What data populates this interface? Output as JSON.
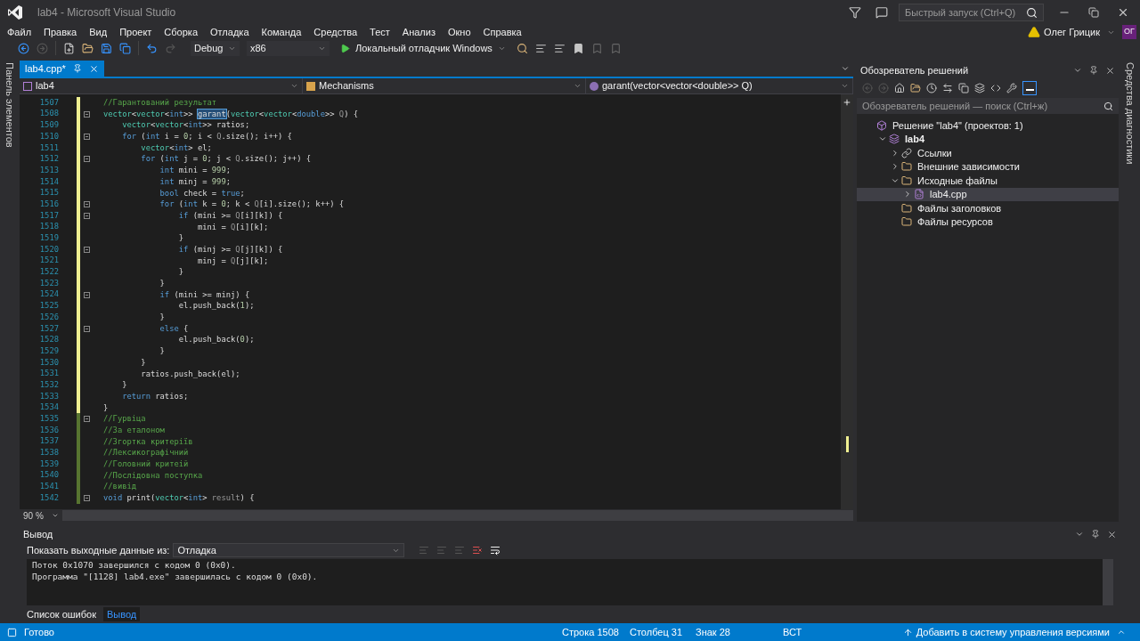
{
  "window": {
    "title": "lab4 - Microsoft Visual Studio"
  },
  "quick_launch": {
    "placeholder": "Быстрый запуск (Ctrl+Q)"
  },
  "user": {
    "name": "Олег Грицик",
    "initials": "ОГ"
  },
  "menu": [
    "Файл",
    "Правка",
    "Вид",
    "Проект",
    "Сборка",
    "Отладка",
    "Команда",
    "Средства",
    "Тест",
    "Анализ",
    "Окно",
    "Справка"
  ],
  "toolbar": {
    "configuration": "Debug",
    "platform": "x86",
    "run": "Локальный отладчик Windows"
  },
  "left_strip": "Панель элементов",
  "right_strip": "Средства диагностики",
  "editor": {
    "tabs": [
      {
        "label": "lab4.cpp*",
        "selected": true
      }
    ],
    "nav": [
      "lab4",
      "Mechanisms",
      "garant(vector<vector<double>> Q)"
    ],
    "zoom": "90 %",
    "lines": [
      {
        "number": "1507",
        "saved": false,
        "foldable": false,
        "tokens": [
          {
            "kind": "comment",
            "text": "//Гарантований результат"
          }
        ]
      },
      {
        "number": "1508",
        "saved": false,
        "foldable": true,
        "tokens": [
          {
            "kind": "type",
            "text": "vector"
          },
          {
            "kind": "plain",
            "text": "<"
          },
          {
            "kind": "type",
            "text": "vector"
          },
          {
            "kind": "plain",
            "text": "<"
          },
          {
            "kind": "kw",
            "text": "int"
          },
          {
            "kind": "plain",
            "text": ">> "
          },
          {
            "kind": "selection",
            "text": "garant"
          },
          {
            "kind": "plain",
            "text": "("
          },
          {
            "kind": "type",
            "text": "vector"
          },
          {
            "kind": "plain",
            "text": "<"
          },
          {
            "kind": "type",
            "text": "vector"
          },
          {
            "kind": "plain",
            "text": "<"
          },
          {
            "kind": "kw",
            "text": "double"
          },
          {
            "kind": "plain",
            "text": ">> "
          },
          {
            "kind": "param",
            "text": "Q"
          },
          {
            "kind": "plain",
            "text": ") {"
          }
        ]
      },
      {
        "number": "1509",
        "saved": false,
        "foldable": false,
        "tokens": [
          {
            "kind": "type",
            "text": "    vector"
          },
          {
            "kind": "plain",
            "text": "<"
          },
          {
            "kind": "type",
            "text": "vector"
          },
          {
            "kind": "plain",
            "text": "<"
          },
          {
            "kind": "kw",
            "text": "int"
          },
          {
            "kind": "plain",
            "text": ">> ratios;"
          }
        ]
      },
      {
        "number": "1510",
        "saved": false,
        "foldable": true,
        "tokens": [
          {
            "kind": "kw",
            "text": "    for"
          },
          {
            "kind": "plain",
            "text": " ("
          },
          {
            "kind": "kw",
            "text": "int"
          },
          {
            "kind": "plain",
            "text": " i = "
          },
          {
            "kind": "num",
            "text": "0"
          },
          {
            "kind": "plain",
            "text": "; i < "
          },
          {
            "kind": "param",
            "text": "Q"
          },
          {
            "kind": "plain",
            "text": ".size(); i++) {"
          }
        ]
      },
      {
        "number": "1511",
        "saved": false,
        "foldable": false,
        "tokens": [
          {
            "kind": "type",
            "text": "        vector"
          },
          {
            "kind": "plain",
            "text": "<"
          },
          {
            "kind": "kw",
            "text": "int"
          },
          {
            "kind": "plain",
            "text": "> el;"
          }
        ]
      },
      {
        "number": "1512",
        "saved": false,
        "foldable": true,
        "tokens": [
          {
            "kind": "kw",
            "text": "        for"
          },
          {
            "kind": "plain",
            "text": " ("
          },
          {
            "kind": "kw",
            "text": "int"
          },
          {
            "kind": "plain",
            "text": " j = "
          },
          {
            "kind": "num",
            "text": "0"
          },
          {
            "kind": "plain",
            "text": "; j < "
          },
          {
            "kind": "param",
            "text": "Q"
          },
          {
            "kind": "plain",
            "text": ".size(); j++) {"
          }
        ]
      },
      {
        "number": "1513",
        "saved": false,
        "foldable": false,
        "tokens": [
          {
            "kind": "kw",
            "text": "            int"
          },
          {
            "kind": "plain",
            "text": " mini = "
          },
          {
            "kind": "num",
            "text": "999"
          },
          {
            "kind": "plain",
            "text": ";"
          }
        ]
      },
      {
        "number": "1514",
        "saved": false,
        "foldable": false,
        "tokens": [
          {
            "kind": "kw",
            "text": "            int"
          },
          {
            "kind": "plain",
            "text": " minj = "
          },
          {
            "kind": "num",
            "text": "999"
          },
          {
            "kind": "plain",
            "text": ";"
          }
        ]
      },
      {
        "number": "1515",
        "saved": false,
        "foldable": false,
        "tokens": [
          {
            "kind": "kw",
            "text": "            bool"
          },
          {
            "kind": "plain",
            "text": " check = "
          },
          {
            "kind": "kw",
            "text": "true"
          },
          {
            "kind": "plain",
            "text": ";"
          }
        ]
      },
      {
        "number": "1516",
        "saved": false,
        "foldable": true,
        "tokens": [
          {
            "kind": "kw",
            "text": "            for"
          },
          {
            "kind": "plain",
            "text": " ("
          },
          {
            "kind": "kw",
            "text": "int"
          },
          {
            "kind": "plain",
            "text": " k = "
          },
          {
            "kind": "num",
            "text": "0"
          },
          {
            "kind": "plain",
            "text": "; k < "
          },
          {
            "kind": "param",
            "text": "Q"
          },
          {
            "kind": "plain",
            "text": "[i].size(); k++) {"
          }
        ]
      },
      {
        "number": "1517",
        "saved": false,
        "foldable": true,
        "tokens": [
          {
            "kind": "kw",
            "text": "                if"
          },
          {
            "kind": "plain",
            "text": " (mini >= "
          },
          {
            "kind": "param",
            "text": "Q"
          },
          {
            "kind": "plain",
            "text": "[i][k]) {"
          }
        ]
      },
      {
        "number": "1518",
        "saved": false,
        "foldable": false,
        "tokens": [
          {
            "kind": "plain",
            "text": "                    mini = "
          },
          {
            "kind": "param",
            "text": "Q"
          },
          {
            "kind": "plain",
            "text": "[i][k];"
          }
        ]
      },
      {
        "number": "1519",
        "saved": false,
        "foldable": false,
        "tokens": [
          {
            "kind": "plain",
            "text": "                }"
          }
        ]
      },
      {
        "number": "1520",
        "saved": false,
        "foldable": true,
        "tokens": [
          {
            "kind": "kw",
            "text": "                if"
          },
          {
            "kind": "plain",
            "text": " (minj >= "
          },
          {
            "kind": "param",
            "text": "Q"
          },
          {
            "kind": "plain",
            "text": "[j][k]) {"
          }
        ]
      },
      {
        "number": "1521",
        "saved": false,
        "foldable": false,
        "tokens": [
          {
            "kind": "plain",
            "text": "                    minj = "
          },
          {
            "kind": "param",
            "text": "Q"
          },
          {
            "kind": "plain",
            "text": "[j][k];"
          }
        ]
      },
      {
        "number": "1522",
        "saved": false,
        "foldable": false,
        "tokens": [
          {
            "kind": "plain",
            "text": "                }"
          }
        ]
      },
      {
        "number": "1523",
        "saved": false,
        "foldable": false,
        "tokens": [
          {
            "kind": "plain",
            "text": "            }"
          }
        ]
      },
      {
        "number": "1524",
        "saved": false,
        "foldable": true,
        "tokens": [
          {
            "kind": "kw",
            "text": "            if"
          },
          {
            "kind": "plain",
            "text": " (mini >= minj) {"
          }
        ]
      },
      {
        "number": "1525",
        "saved": false,
        "foldable": false,
        "tokens": [
          {
            "kind": "plain",
            "text": "                el.push_back("
          },
          {
            "kind": "num",
            "text": "1"
          },
          {
            "kind": "plain",
            "text": ");"
          }
        ]
      },
      {
        "number": "1526",
        "saved": false,
        "foldable": false,
        "tokens": [
          {
            "kind": "plain",
            "text": "            }"
          }
        ]
      },
      {
        "number": "1527",
        "saved": false,
        "foldable": true,
        "tokens": [
          {
            "kind": "kw",
            "text": "            else"
          },
          {
            "kind": "plain",
            "text": " {"
          }
        ]
      },
      {
        "number": "1528",
        "saved": false,
        "foldable": false,
        "tokens": [
          {
            "kind": "plain",
            "text": "                el.push_back("
          },
          {
            "kind": "num",
            "text": "0"
          },
          {
            "kind": "plain",
            "text": ");"
          }
        ]
      },
      {
        "number": "1529",
        "saved": false,
        "foldable": false,
        "tokens": [
          {
            "kind": "plain",
            "text": "            }"
          }
        ]
      },
      {
        "number": "1530",
        "saved": false,
        "foldable": false,
        "tokens": [
          {
            "kind": "plain",
            "text": "        }"
          }
        ]
      },
      {
        "number": "1531",
        "saved": false,
        "foldable": false,
        "tokens": [
          {
            "kind": "plain",
            "text": "        ratios.push_back(el);"
          }
        ]
      },
      {
        "number": "1532",
        "saved": false,
        "foldable": false,
        "tokens": [
          {
            "kind": "plain",
            "text": "    }"
          }
        ]
      },
      {
        "number": "1533",
        "saved": false,
        "foldable": false,
        "tokens": [
          {
            "kind": "kw",
            "text": "    return"
          },
          {
            "kind": "plain",
            "text": " ratios;"
          }
        ]
      },
      {
        "number": "1534",
        "saved": false,
        "foldable": false,
        "tokens": [
          {
            "kind": "plain",
            "text": "}"
          }
        ]
      },
      {
        "number": "1535",
        "saved": true,
        "foldable": true,
        "tokens": [
          {
            "kind": "comment",
            "text": "//Гурвіца"
          }
        ]
      },
      {
        "number": "1536",
        "saved": true,
        "foldable": false,
        "tokens": [
          {
            "kind": "comment",
            "text": "//За еталоном"
          }
        ]
      },
      {
        "number": "1537",
        "saved": true,
        "foldable": false,
        "tokens": [
          {
            "kind": "comment",
            "text": "//Згортка критеріїв"
          }
        ]
      },
      {
        "number": "1538",
        "saved": true,
        "foldable": false,
        "tokens": [
          {
            "kind": "comment",
            "text": "//Лексикографічний"
          }
        ]
      },
      {
        "number": "1539",
        "saved": true,
        "foldable": false,
        "tokens": [
          {
            "kind": "comment",
            "text": "//Головний критеій"
          }
        ]
      },
      {
        "number": "1540",
        "saved": true,
        "foldable": false,
        "tokens": [
          {
            "kind": "comment",
            "text": "//Послідовна поступка"
          }
        ]
      },
      {
        "number": "1541",
        "saved": true,
        "foldable": false,
        "tokens": [
          {
            "kind": "comment",
            "text": "//вивід"
          }
        ]
      },
      {
        "number": "1542",
        "saved": true,
        "foldable": true,
        "tokens": [
          {
            "kind": "kw",
            "text": "void"
          },
          {
            "kind": "plain",
            "text": " print("
          },
          {
            "kind": "type",
            "text": "vector"
          },
          {
            "kind": "plain",
            "text": "<"
          },
          {
            "kind": "kw",
            "text": "int"
          },
          {
            "kind": "plain",
            "text": "> "
          },
          {
            "kind": "param",
            "text": "result"
          },
          {
            "kind": "plain",
            "text": ") {"
          }
        ]
      }
    ]
  },
  "solution_explorer": {
    "title": "Обозреватель решений",
    "search": {
      "placeholder": "Обозреватель решений — поиск (Ctrl+ж)"
    },
    "tree": [
      {
        "label": "Решение \"lab4\"  (проектов: 1)",
        "kind": "solution",
        "selected": false,
        "children": [
          {
            "label": "lab4",
            "kind": "project",
            "expanded": true,
            "selected": false,
            "children": [
              {
                "label": "Ссылки",
                "kind": "references",
                "expanded": false,
                "selected": false
              },
              {
                "label": "Внешние зависимости",
                "kind": "external",
                "expanded": false,
                "selected": false
              },
              {
                "label": "Исходные файлы",
                "kind": "folder",
                "expanded": true,
                "selected": false,
                "children": [
                  {
                    "label": "lab4.cpp",
                    "kind": "file",
                    "expanded": false,
                    "selected": true
                  }
                ]
              },
              {
                "label": "Файлы заголовков",
                "kind": "folder",
                "selected": false
              },
              {
                "label": "Файлы ресурсов",
                "kind": "folder",
                "selected": false
              }
            ]
          }
        ]
      }
    ]
  },
  "output": {
    "title": "Вывод",
    "source_label": "Показать выходные данные из:",
    "source": "Отладка",
    "lines": [
      "Поток 0x1070 завершился с кодом 0 (0x0).",
      "Программа \"[1128] lab4.exe\" завершилась с кодом 0 (0x0)."
    ]
  },
  "bottom_tabs": [
    {
      "label": "Список ошибок",
      "selected": false
    },
    {
      "label": "Вывод",
      "selected": true
    }
  ],
  "status_bar": {
    "message": "Готово",
    "line": "Строка 1508",
    "column": "Столбец 31",
    "char": "Знак 28",
    "mode": "ВСТ",
    "source_control": "Добавить в систему управления версиями"
  }
}
